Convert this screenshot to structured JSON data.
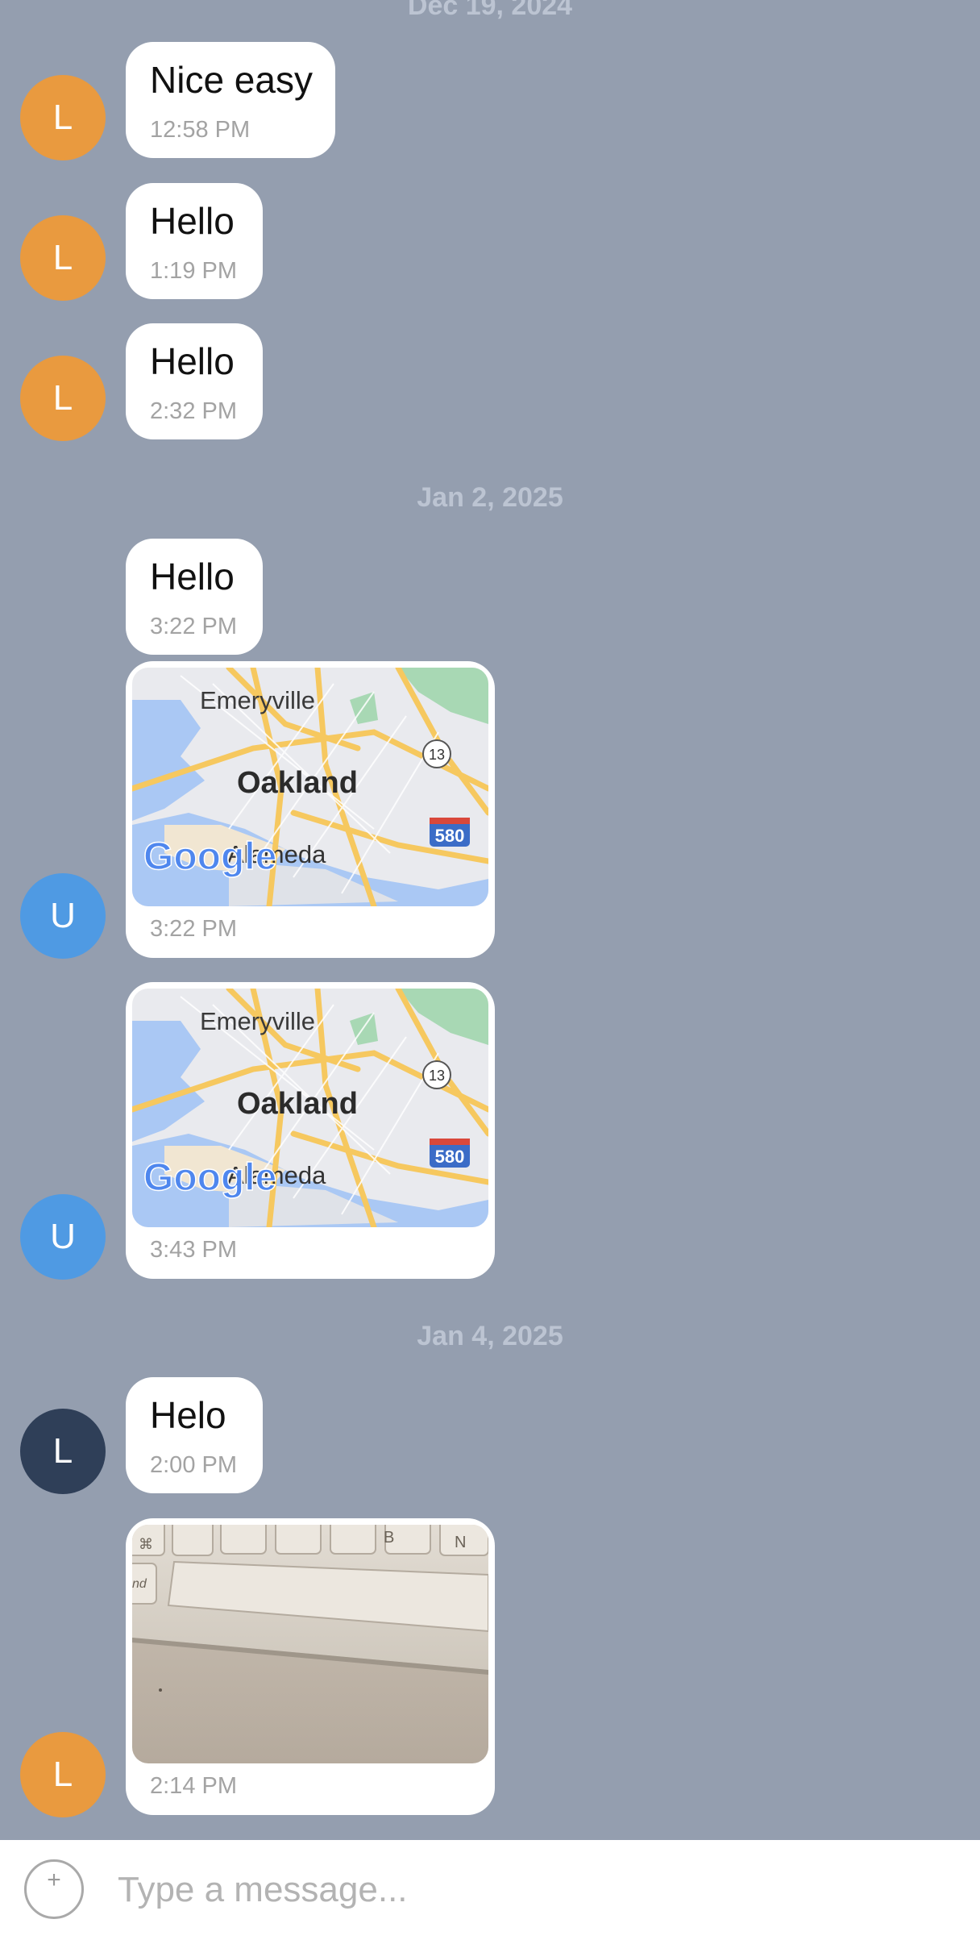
{
  "chat": {
    "date_separators": [
      "Dec 19, 2024",
      "Jan 2, 2025",
      "Jan 4, 2025"
    ],
    "messages": [
      {
        "avatar": "L",
        "text": "Nice easy",
        "time": "12:58 PM"
      },
      {
        "avatar": "L",
        "text": "Hello",
        "time": "1:19 PM"
      },
      {
        "avatar": "L",
        "text": "Hello",
        "time": "2:32 PM"
      },
      {
        "text": "Hello",
        "time": "3:22 PM"
      },
      {
        "avatar": "U",
        "type": "map",
        "time": "3:22 PM"
      },
      {
        "avatar": "U",
        "type": "map",
        "time": "3:43 PM"
      },
      {
        "avatar": "L",
        "text": "Helo",
        "time": "2:00 PM"
      },
      {
        "avatar": "L",
        "type": "photo",
        "time": "2:14 PM"
      }
    ],
    "map": {
      "labels": [
        "Emeryville",
        "Oakland",
        "Alameda"
      ],
      "route_shields": [
        "13",
        "580"
      ],
      "logo": "Google"
    }
  },
  "composer": {
    "placeholder": "Type a message...",
    "add_icon": "plus-circle-icon"
  },
  "colors": {
    "background": "#949eaf",
    "avatar_orange": "#e99a3f",
    "avatar_blue": "#4f9ae3",
    "avatar_dark": "#2f3f58",
    "bubble": "#ffffff"
  }
}
